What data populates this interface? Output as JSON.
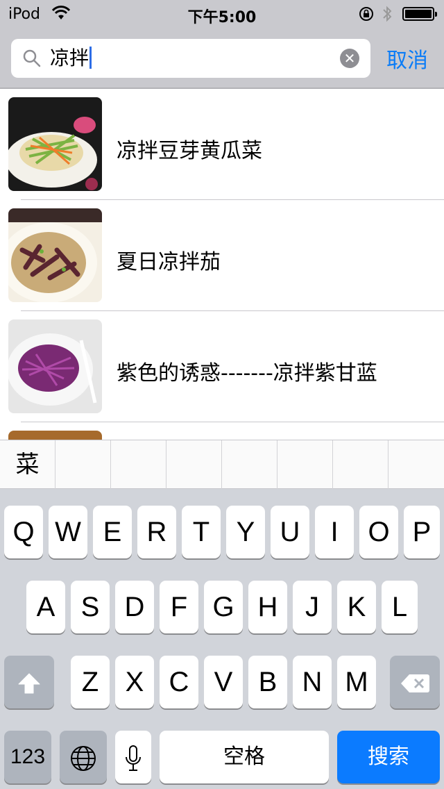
{
  "status_bar": {
    "carrier": "iPod",
    "time": "下午5:00"
  },
  "search": {
    "query": "凉拌",
    "cancel_label": "取消"
  },
  "results": [
    {
      "title": "凉拌豆芽黄瓜菜"
    },
    {
      "title": "夏日凉拌茄"
    },
    {
      "title": "紫色的诱惑-------凉拌紫甘蓝"
    }
  ],
  "candidates": [
    "菜"
  ],
  "keyboard": {
    "row1": [
      "Q",
      "W",
      "E",
      "R",
      "T",
      "Y",
      "U",
      "I",
      "O",
      "P"
    ],
    "row2": [
      "A",
      "S",
      "D",
      "F",
      "G",
      "H",
      "J",
      "K",
      "L"
    ],
    "row3": [
      "Z",
      "X",
      "C",
      "V",
      "B",
      "N",
      "M"
    ],
    "numbers_label": "123",
    "space_label": "空格",
    "search_label": "搜索"
  },
  "colors": {
    "accent": "#0a7cf7",
    "search_key": "#0b7bff",
    "keyboard_bg": "#d1d4da",
    "header_bg": "#c9c9ce"
  },
  "icons": [
    "wifi-icon",
    "orientation-lock-icon",
    "bluetooth-icon",
    "battery-icon",
    "search-icon",
    "clear-icon",
    "shift-icon",
    "backspace-icon",
    "globe-icon",
    "microphone-icon"
  ]
}
